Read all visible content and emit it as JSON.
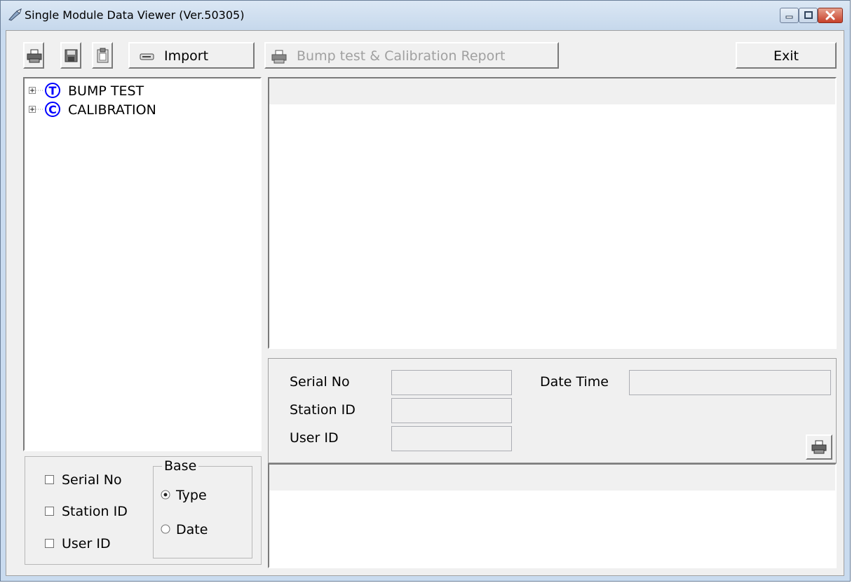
{
  "window": {
    "title": "Single Module Data Viewer (Ver.50305)",
    "icons": [
      "app-icon",
      "minimize-icon",
      "maximize-icon",
      "close-icon"
    ]
  },
  "toolbar": {
    "print_icon": "printer-icon",
    "save_icon": "floppy-disk-icon",
    "paste_icon": "clipboard-icon",
    "import_label": "Import",
    "report_label": "Bump test & Calibration Report",
    "exit_label": "Exit"
  },
  "tree": {
    "items": [
      {
        "badge": "T",
        "label": "BUMP TEST"
      },
      {
        "badge": "C",
        "label": "CALIBRATION"
      }
    ]
  },
  "filter": {
    "checkboxes": [
      {
        "label": "Serial No",
        "checked": false
      },
      {
        "label": "Station ID",
        "checked": false
      },
      {
        "label": "User ID",
        "checked": false
      }
    ],
    "base_group_label": "Base",
    "radios": [
      {
        "label": "Type",
        "selected": true
      },
      {
        "label": "Date",
        "selected": false
      }
    ]
  },
  "details": {
    "serial_no_label": "Serial No",
    "serial_no_value": "",
    "station_id_label": "Station ID",
    "station_id_value": "",
    "user_id_label": "User ID",
    "user_id_value": "",
    "date_time_label": "Date Time",
    "date_time_value": ""
  },
  "colors": {
    "tree_badge": "#0000ff",
    "window_frame": "#c9dbef",
    "close_button": "#c7402a"
  }
}
